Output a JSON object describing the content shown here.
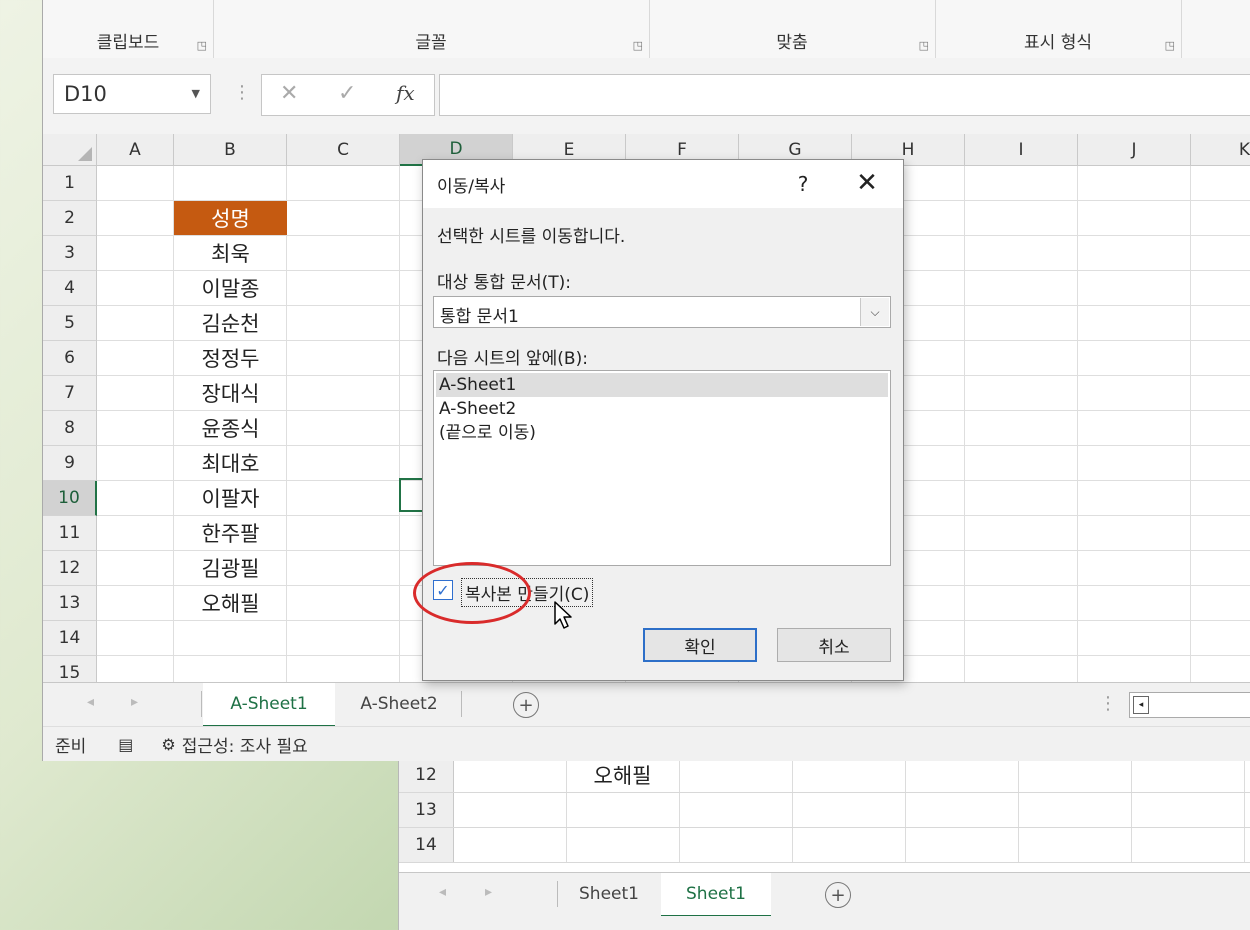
{
  "ribbon": {
    "groups": [
      "클립보드",
      "글꼴",
      "맞춤",
      "표시 형식"
    ]
  },
  "formula_bar": {
    "name_box": "D10",
    "cancel_icon": "✕",
    "enter_icon": "✓",
    "fx_label": "fx",
    "formula": ""
  },
  "grid": {
    "columns": [
      "A",
      "B",
      "C",
      "D",
      "E",
      "F",
      "G",
      "H",
      "I",
      "J",
      "K"
    ],
    "selected_column": "D",
    "rows": [
      "1",
      "2",
      "3",
      "4",
      "5",
      "6",
      "7",
      "8",
      "9",
      "10",
      "11",
      "12",
      "13",
      "14",
      "15"
    ],
    "selected_row": "10",
    "column_b": [
      "",
      "성명",
      "최욱",
      "이말종",
      "김순천",
      "정정두",
      "장대식",
      "윤종식",
      "최대호",
      "이팔자",
      "한주팔",
      "김광필",
      "오해필",
      "",
      ""
    ],
    "header_fill": "#c55a11"
  },
  "sheet_tabs": {
    "tabs": [
      "A-Sheet1",
      "A-Sheet2"
    ],
    "active": "A-Sheet1"
  },
  "status_bar": {
    "ready": "준비",
    "accessibility": "접근성: 조사 필요"
  },
  "dialog": {
    "title": "이동/복사",
    "help": "?",
    "close": "✕",
    "intro": "선택한 시트를 이동합니다.",
    "target_label": "대상 통합 문서(T):",
    "target_value": "통합 문서1",
    "before_label": "다음 시트의 앞에(B):",
    "sheet_list": [
      "A-Sheet1",
      "A-Sheet2",
      "(끝으로 이동)"
    ],
    "selected_sheet": "A-Sheet1",
    "copy_checkbox_label": "복사본 만들기(C)",
    "copy_checked": true,
    "ok": "확인",
    "cancel": "취소",
    "accent": "#2d6fc8"
  },
  "background_window": {
    "rows": [
      "12",
      "13",
      "14"
    ],
    "row12_value": "오해필",
    "tabs": [
      "Sheet1",
      "Sheet1"
    ],
    "active_tab_index": 1
  }
}
